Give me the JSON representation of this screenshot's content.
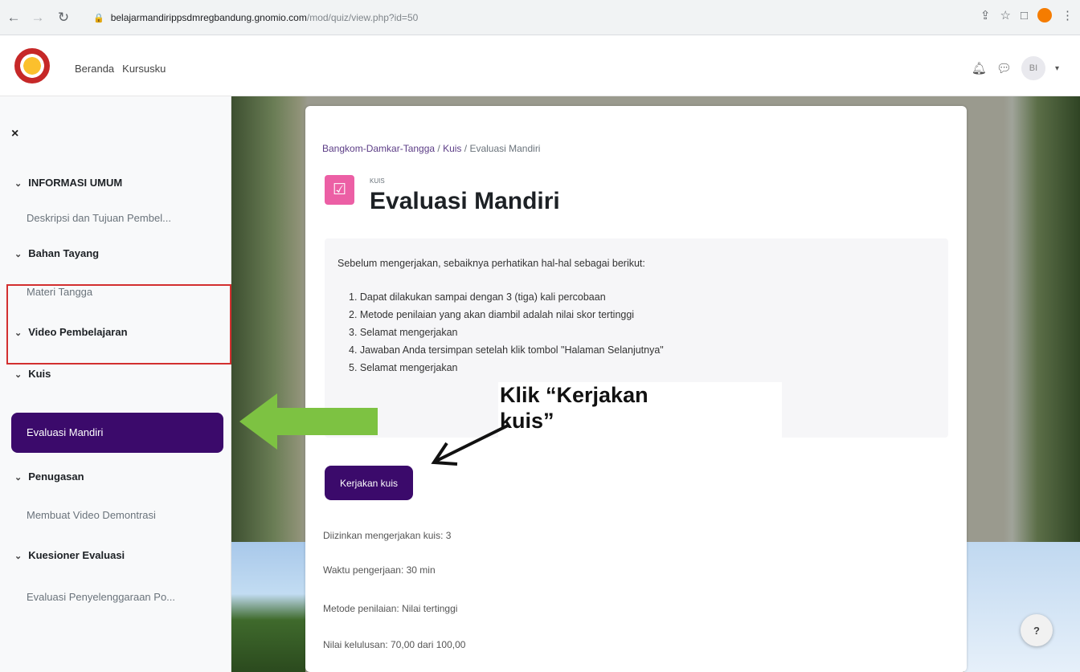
{
  "browser": {
    "url_host": "belajarmandirippsdmregbandung.gnomio.com",
    "url_path": "/mod/quiz/view.php?id=50"
  },
  "topbar": {
    "nav": [
      "Beranda",
      "Kursusku"
    ],
    "avatar_initials": "BI"
  },
  "sidebar": {
    "close": "×",
    "sections": [
      {
        "title": "INFORMASI UMUM",
        "items": [
          "Deskripsi dan Tujuan Pembel..."
        ]
      },
      {
        "title": "Bahan Tayang",
        "items": [
          "Materi Tangga"
        ]
      },
      {
        "title": "Video Pembelajaran",
        "items": []
      },
      {
        "title": "Kuis",
        "items": [
          "Evaluasi Mandiri"
        ]
      },
      {
        "title": "Penugasan",
        "items": [
          "Membuat Video Demontrasi"
        ]
      },
      {
        "title": "Kuesioner Evaluasi",
        "items": [
          "Evaluasi Penyelenggaraan Po..."
        ]
      }
    ]
  },
  "breadcrumb": [
    "Bangkom-Damkar-Tangga",
    "Kuis",
    "Evaluasi Mandiri"
  ],
  "activity": {
    "type_label": "KUIS",
    "title": "Evaluasi Mandiri"
  },
  "description": {
    "intro": "Sebelum mengerjakan, sebaiknya perhatikan hal-hal sebagai berikut:",
    "items": [
      "1. Dapat dilakukan sampai dengan 3 (tiga) kali percobaan",
      "2. Metode penilaian yang akan diambil adalah nilai skor tertinggi",
      "3. Selamat mengerjakan",
      "4. Jawaban Anda tersimpan setelah klik tombol \"Halaman Selanjutnya\"",
      "5. Selamat mengerjakan"
    ]
  },
  "annotation": {
    "callout_line1": "Klik “Kerjakan",
    "callout_line2": "kuis”",
    "arrow_color": "#7dc242"
  },
  "quiz": {
    "start_button": "Kerjakan kuis",
    "attempts": "Diizinkan mengerjakan kuis: 3",
    "time": "Waktu pengerjaan: 30 min",
    "method": "Metode penilaian: Nilai tertinggi",
    "pass": "Nilai kelulusan: 70,00 dari 100,00"
  },
  "help": "?"
}
